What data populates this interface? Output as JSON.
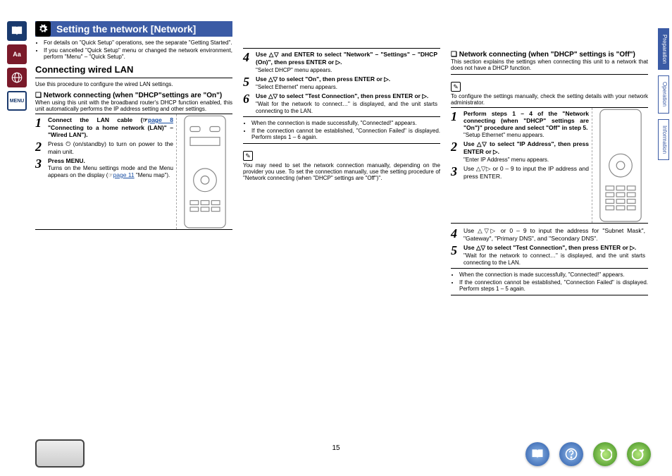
{
  "title": "Setting the network [Network]",
  "intro_bullets": [
    "For details on \"Quick Setup\" operations, see the separate \"Getting Started\".",
    "If you cancelled \"Quick Setup\" menu or changed the network environment, perform \"Menu\" – \"Quick Setup\"."
  ],
  "connecting_heading": "Connecting wired LAN",
  "connecting_intro": "Use this procedure to configure the wired LAN settings.",
  "dhcp_on": {
    "heading": "Network connecting (when \"DHCP\"settings are \"On\")",
    "intro": "When using this unit with the broadband router's DHCP function enabled, this unit automatically performs the IP address setting and other settings.",
    "steps": [
      {
        "n": "1",
        "bold": "Connect the LAN cable (☞",
        "link": "page 8",
        "after": " \"Connecting to a home network (LAN)\" – \"Wired LAN\")."
      },
      {
        "n": "2",
        "bold": "Press ⏻ (on/standby) to turn on power to the main unit."
      },
      {
        "n": "3",
        "bold": "Press MENU.",
        "note": "Turns on the Menu settings mode and the Menu appears on the display (☞",
        "link2": "page 11",
        "note2": " \"Menu map\")."
      }
    ]
  },
  "col2_steps": [
    {
      "n": "4",
      "bold": "Use △▽ and ENTER to select \"Network\" – \"Settings\" – \"DHCP (On)\", then press ENTER or ▷.",
      "note": "\"Select DHCP\" menu appears."
    },
    {
      "n": "5",
      "bold": "Use △▽ to select \"On\", then press ENTER or ▷.",
      "note": "\"Select Ethernet\" menu appears."
    },
    {
      "n": "6",
      "bold": "Use △▽ to select \"Test Connection\", then press ENTER or ▷.",
      "note": "\"Wait for the network to connect…\" is displayed, and the unit starts connecting to the LAN."
    }
  ],
  "col2_results": [
    "When the connection is made successfully, \"Connected!\" appears.",
    "If the connection cannot be established, \"Connection Failed\" is displayed. Perform steps 1 – 6 again."
  ],
  "col2_note": "You may need to set the network connection manually, depending on the provider you use. To set the connection manually, use the setting procedure of \"Network connecting (when \"DHCP\" settings are \"Off\")\".",
  "dhcp_off": {
    "heading": "Network connecting (when \"DHCP\" settings is \"Off\")",
    "intro": "This section explains the settings when connecting this unit to a network that does not have a DHCP function.",
    "note": "To configure the settings manually, check the setting details with your network administrator.",
    "steps": [
      {
        "n": "1",
        "bold": "Perform steps 1 – 4 of the \"Network connecting (when \"DHCP\" settings are \"On\")\" procedure and select \"Off\" in step 5.",
        "note": "\"Setup Ethernet\" menu appears."
      },
      {
        "n": "2",
        "bold": "Use △▽ to select \"IP Address\", then press ENTER or ▷.",
        "note": "\"Enter IP Address\" menu appears."
      },
      {
        "n": "3",
        "bold": "Use △▽▷ or 0 – 9 to input the IP address and press ENTER."
      },
      {
        "n": "4",
        "bold": "Use △▽▷ or 0 – 9 to input the address for \"Subnet Mask\", \"Gateway\", \"Primary DNS\", and \"Secondary DNS\"."
      },
      {
        "n": "5",
        "bold": "Use △▽ to select \"Test Connection\", then press ENTER or ▷.",
        "note": "\"Wait for the network to connect…\" is displayed, and the unit starts connecting to the LAN."
      }
    ],
    "results": [
      "When the connection is made successfully, \"Connected!\" appears.",
      "If the connection cannot be established, \"Connection Failed\" is displayed. Perform steps 1 – 5 again."
    ]
  },
  "side_tabs": [
    "Preparation",
    "Operation",
    "Information"
  ],
  "rail": [
    "book",
    "Aa",
    "globe",
    "MENU"
  ],
  "page_number": "15",
  "nav_buttons": [
    "book-icon",
    "help-icon",
    "back-icon",
    "forward-icon"
  ]
}
